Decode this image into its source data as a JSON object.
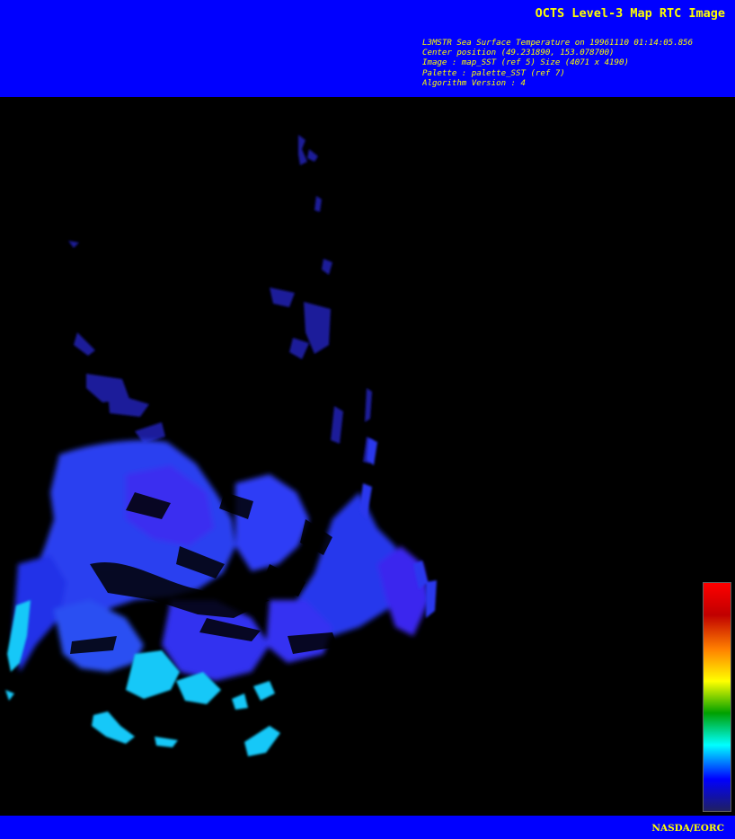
{
  "header": {
    "title": "OCTS Level-3 Map RTC Image",
    "meta_lines": [
      "L3MSTR Sea Surface Temperature on 19961110 01:14:05.856",
      "Center position (49.231890, 153.078700)",
      "Image : map_SST (ref 5) Size (4071 x 4190)",
      "Palette : palette_SST (ref 7)",
      "Algorithm Version : 4"
    ]
  },
  "image": {
    "description_colors": {
      "background": "#000000",
      "banner": "#0000ff",
      "text": "#ffff00"
    }
  },
  "colorbar": {
    "colors_bottom_to_top": [
      "#202060",
      "#0000ff",
      "#00ffff",
      "#00a000",
      "#ffff00",
      "#ff8000",
      "#c00000",
      "#ff0000"
    ]
  },
  "footer": {
    "credit": "NASDA/EORC"
  }
}
